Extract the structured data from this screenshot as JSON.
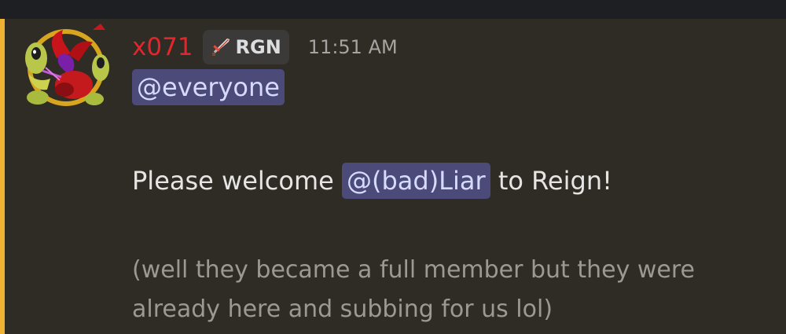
{
  "message": {
    "author": "x071",
    "author_color": "#e3262b",
    "tag": {
      "icon": "sword-icon",
      "label": "RGN"
    },
    "timestamp": "11:51 AM",
    "mention_everyone": "@everyone",
    "welcome": {
      "before": "Please welcome ",
      "mention": "@(bad)Liar",
      "after": " to Reign!"
    },
    "note_line1": "(well they became a full member but they were",
    "note_line2": "already here and subbing for us lol)",
    "highlight_color": "#f0b232",
    "mention_bg": "#4c4a79"
  }
}
